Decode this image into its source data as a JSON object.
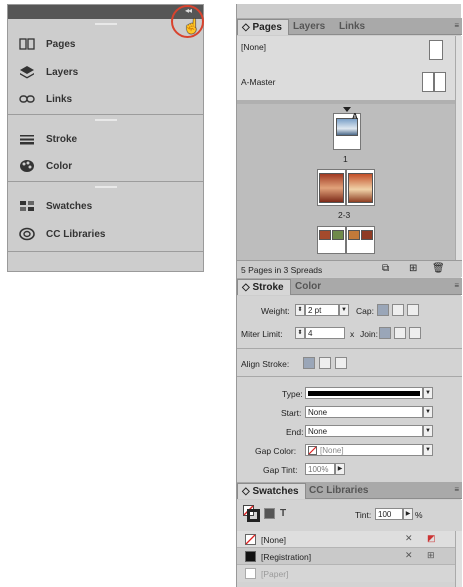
{
  "left_dock": {
    "items": [
      {
        "label": "Pages",
        "icon": "pages-icon"
      },
      {
        "label": "Layers",
        "icon": "layers-icon"
      },
      {
        "label": "Links",
        "icon": "links-icon"
      },
      {
        "label": "Stroke",
        "icon": "stroke-icon"
      },
      {
        "label": "Color",
        "icon": "color-icon"
      },
      {
        "label": "Swatches",
        "icon": "swatches-icon"
      },
      {
        "label": "CC Libraries",
        "icon": "cc-libraries-icon"
      }
    ],
    "collapse_glyph": "◂◂",
    "callout_color": "#d8432e"
  },
  "pages_panel": {
    "tabs": [
      "Pages",
      "Layers",
      "Links"
    ],
    "active_tab": "Pages",
    "masters": [
      "[None]",
      "A-Master"
    ],
    "page_numbers": [
      "1",
      "2-3"
    ],
    "master_letter": "A",
    "footer_status": "5 Pages in 3 Spreads"
  },
  "stroke_panel": {
    "tabs": [
      "Stroke",
      "Color"
    ],
    "active_tab": "Stroke",
    "weight_label": "Weight:",
    "weight_value": "2 pt",
    "cap_label": "Cap:",
    "miter_label": "Miter Limit:",
    "miter_value": "4",
    "miter_x": "x",
    "join_label": "Join:",
    "align_label": "Align Stroke:",
    "type_label": "Type:",
    "start_label": "Start:",
    "start_value": "None",
    "end_label": "End:",
    "end_value": "None",
    "gap_color_label": "Gap Color:",
    "gap_color_value": "[None]",
    "gap_tint_label": "Gap Tint:",
    "gap_tint_value": "100%"
  },
  "swatches_panel": {
    "tabs": [
      "Swatches",
      "CC Libraries"
    ],
    "active_tab": "Swatches",
    "tint_label": "Tint:",
    "tint_value": "100",
    "tint_unit": "%",
    "text_toggle": "T",
    "swatches": [
      "[None]",
      "[Registration]",
      "[Paper]"
    ]
  }
}
